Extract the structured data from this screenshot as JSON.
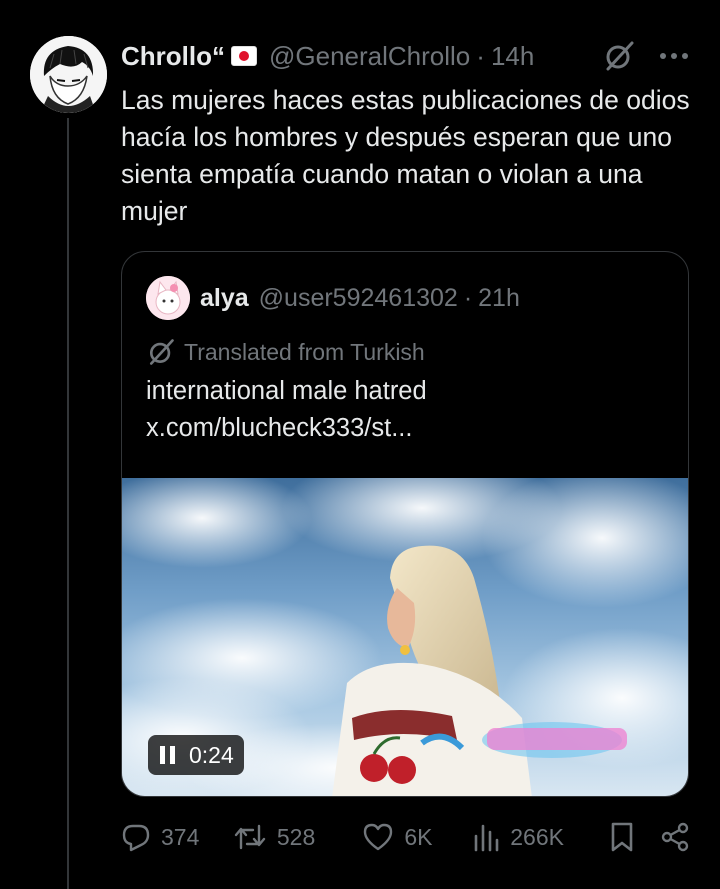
{
  "tweet": {
    "display_name": "Chrollo“",
    "handle": "@GeneralChrollo",
    "separator": "·",
    "time": "14h",
    "text": "Las mujeres haces estas publicaciones de odios hacía los hombres y después esperan que uno sienta empatía cuando matan o violan a una mujer"
  },
  "quote": {
    "display_name": "alya",
    "handle": "@user592461302",
    "separator": "·",
    "time": "21h",
    "translated_label": "Translated from Turkish",
    "text_line1": "international male hatred",
    "text_line2": "x.com/blucheck333/st..."
  },
  "video": {
    "duration": "0:24",
    "state_icon": "pause-icon"
  },
  "actions": {
    "replies": "374",
    "retweets": "528",
    "likes": "6K",
    "views": "266K"
  },
  "icons": [
    "grok-translate-icon",
    "more-icon",
    "reply-icon",
    "retweet-icon",
    "like-icon",
    "views-icon",
    "bookmark-icon",
    "share-icon"
  ],
  "colors": {
    "background": "#000000",
    "text": "#e7e9ea",
    "muted": "#71767b",
    "border": "#333639"
  }
}
